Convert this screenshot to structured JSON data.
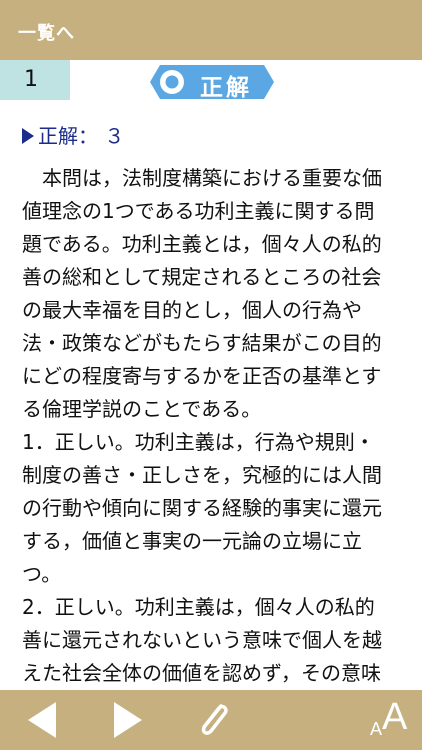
{
  "header": {
    "back_label": "一覧へ"
  },
  "question": {
    "number": "1"
  },
  "result": {
    "label": "正解",
    "icon": "circle-icon",
    "color": "#5aa7e3"
  },
  "answer": {
    "text": "正解： ３"
  },
  "explanation": {
    "lines": [
      "　本問は，法制度構築における重要な価",
      "値理念の1つである功利主義に関する問",
      "題である。功利主義とは，個々人の私的",
      "善の総和として規定されるところの社会",
      "の最大幸福を目的とし，個人の行為や",
      "法・政策などがもたらす結果がこの目的",
      "にどの程度寄与するかを正否の基準とす",
      "る倫理学説のことである。",
      "1．正しい。功利主義は，行為や規則・",
      "制度の善さ・正しさを，究極的には人間",
      "の行動や傾向に関する経験的事実に還元",
      "する，価値と事実の一元論の立場に立",
      "つ。",
      "2．正しい。功利主義は，個々人の私的",
      "善に還元されないという意味で個人を越",
      "えた社会全体の価値を認めず，その意味"
    ]
  },
  "footer": {
    "prev_icon": "triangle-left-icon",
    "next_icon": "triangle-right-icon",
    "attach_icon": "paperclip-icon",
    "font_small": "A",
    "font_large": "A"
  },
  "colors": {
    "bar": "#c6b07f",
    "qnum_bg": "#bfe2e2",
    "answer_text": "#1c2c8a"
  }
}
